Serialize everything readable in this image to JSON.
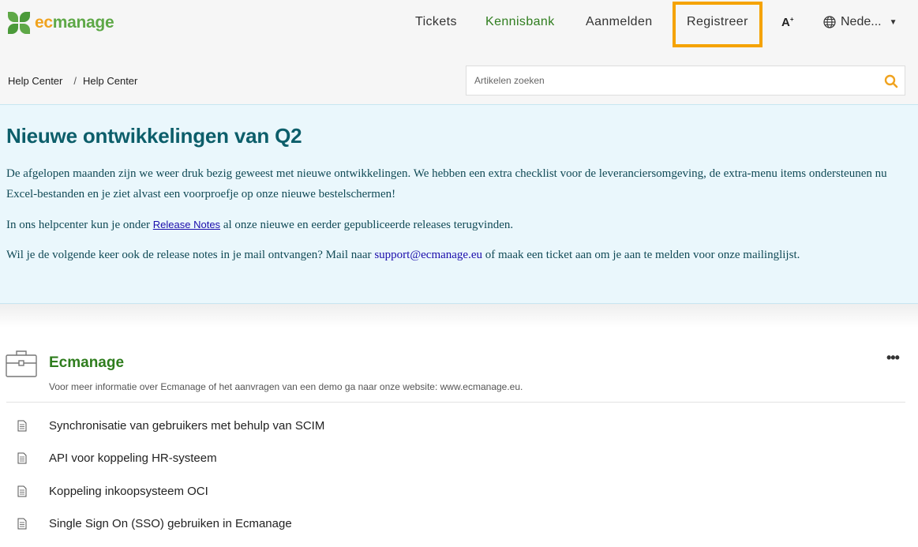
{
  "logo": {
    "part1": "ec",
    "part2": "manage"
  },
  "nav": {
    "tickets": "Tickets",
    "kennisbank": "Kennisbank",
    "aanmelden": "Aanmelden",
    "registreer": "Registreer",
    "font_size": "A",
    "font_size_sup": "+",
    "language": "Nede..."
  },
  "breadcrumb": {
    "items": [
      "Help Center",
      "Help Center"
    ],
    "separator": "/"
  },
  "search": {
    "placeholder": "Artikelen zoeken"
  },
  "banner": {
    "title": "Nieuwe ontwikkelingen van Q2",
    "p1": "De afgelopen maanden zijn we weer druk bezig geweest met nieuwe ontwikkelingen. We hebben een extra checklist voor de leveranciersomgeving, de extra-menu items ondersteunen nu Excel-bestanden en je ziet alvast een voorproefje op onze nieuwe bestelschermen!",
    "p2_before": "In ons helpcenter kun je onder ",
    "p2_link": "Release Notes",
    "p2_after": " al onze nieuwe en eerder gepubliceerde releases terugvinden.",
    "p3_before": "Wil je de volgende keer ook de release notes in je mail ontvangen? Mail naar ",
    "p3_mail": "support@ecmanage.eu",
    "p3_after": " of maak een ticket aan om je aan te melden voor onze mailinglijst."
  },
  "category": {
    "title": "Ecmanage",
    "description": "Voor meer informatie over Ecmanage of het aanvragen van een demo ga naar onze website: www.ecmanage.eu.",
    "more": "•••"
  },
  "articles": [
    "Synchronisatie van gebruikers met behulp van SCIM",
    "API voor koppeling HR-systeem",
    "Koppeling inkoopsysteem OCI",
    "Single Sign On (SSO) gebruiken in Ecmanage"
  ],
  "colors": {
    "accent_green": "#2f7d1e",
    "highlight_orange": "#f5a300",
    "banner_bg": "#eaf7fc",
    "banner_title": "#0c5e6a"
  }
}
